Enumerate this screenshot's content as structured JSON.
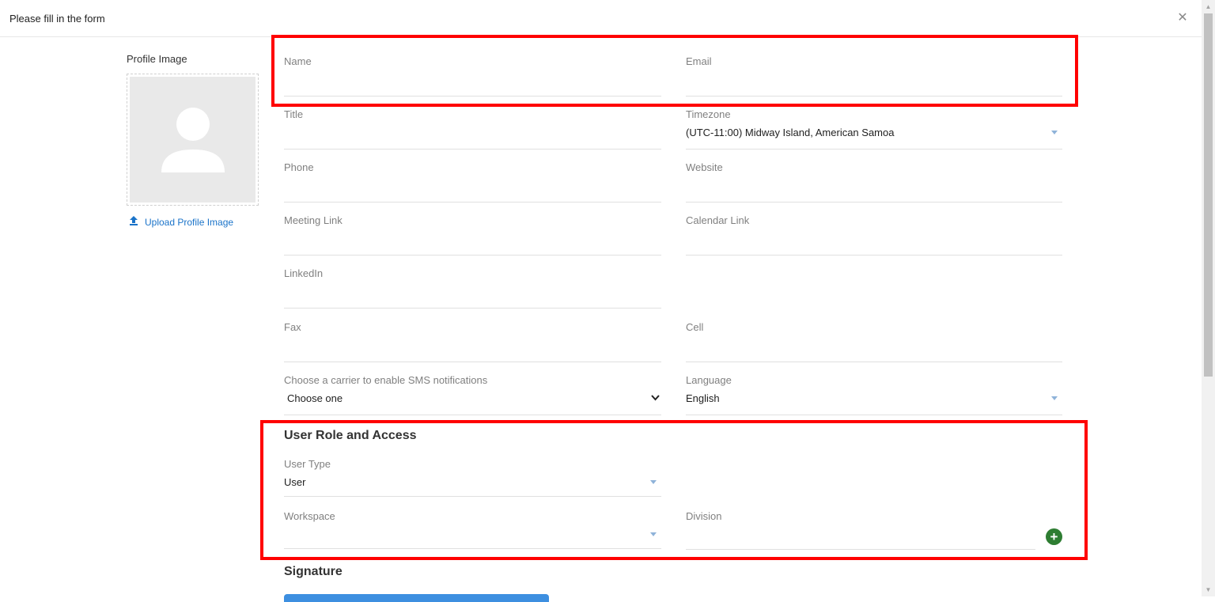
{
  "header": {
    "title": "Please fill in the form",
    "close_icon": "close-icon"
  },
  "profile": {
    "label": "Profile Image",
    "upload_label": "Upload Profile Image",
    "avatar_icon": "user-placeholder-icon",
    "upload_icon": "upload-icon"
  },
  "form": {
    "name": {
      "label": "Name",
      "value": ""
    },
    "email": {
      "label": "Email",
      "value": ""
    },
    "title": {
      "label": "Title",
      "value": ""
    },
    "timezone": {
      "label": "Timezone",
      "value": "(UTC-11:00) Midway Island, American Samoa"
    },
    "phone": {
      "label": "Phone",
      "value": ""
    },
    "website": {
      "label": "Website",
      "value": ""
    },
    "meeting_link": {
      "label": "Meeting Link",
      "value": ""
    },
    "calendar_link": {
      "label": "Calendar Link",
      "value": ""
    },
    "linkedin": {
      "label": "LinkedIn",
      "value": ""
    },
    "fax": {
      "label": "Fax",
      "value": ""
    },
    "cell": {
      "label": "Cell",
      "value": ""
    },
    "carrier": {
      "label": "Choose a carrier to enable SMS notifications",
      "value": "Choose one"
    },
    "language": {
      "label": "Language",
      "value": "English"
    }
  },
  "role_section": {
    "title": "User Role and Access",
    "user_type": {
      "label": "User Type",
      "value": "User"
    },
    "workspace": {
      "label": "Workspace",
      "value": ""
    },
    "division": {
      "label": "Division",
      "value": ""
    },
    "add_icon": "plus-circle-icon"
  },
  "signature": {
    "title": "Signature"
  },
  "colors": {
    "highlight": "#ff0000",
    "link": "#1a73c9",
    "add_button": "#2e7d32",
    "dropdown_arrow": "#8fb3d9"
  }
}
